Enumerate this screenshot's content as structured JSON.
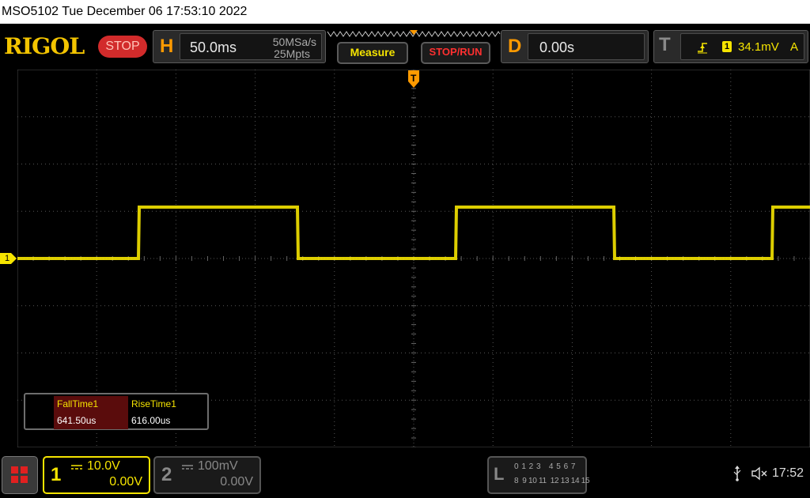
{
  "title_bar": {
    "text": "MSO5102  Tue December 06 17:53:10 2022"
  },
  "brand": {
    "logo_text": "RIGOL",
    "logo_color": "#f3c400"
  },
  "run_state": {
    "label": "STOP",
    "color": "#d22b2b"
  },
  "horizontal": {
    "letter": "H",
    "timebase": "50.0ms",
    "sample_rate": "50MSa/s",
    "memory_depth": "25Mpts"
  },
  "buttons": {
    "measure": "Measure",
    "stop_run": "STOP/RUN"
  },
  "delay": {
    "letter": "D",
    "value": "0.00s"
  },
  "trigger": {
    "letter": "T",
    "source_badge": "1",
    "level": "34.1mV",
    "mode": "A"
  },
  "channel_marker": "1",
  "trigger_marker": "T",
  "measurements": {
    "headers": [
      "FallTime1",
      "RiseTime1"
    ],
    "values": [
      "641.50us",
      "616.00us"
    ]
  },
  "channel1": {
    "number": "1",
    "scale": "10.0V",
    "offset": "0.00V",
    "color": "#f5e400"
  },
  "channel2": {
    "number": "2",
    "scale": "100mV",
    "offset": "0.00V"
  },
  "logic": {
    "letter": "L",
    "row1": "0 1 2 3   4 5 6 7",
    "row2": "8  9 10 11  12 13 14 15"
  },
  "status": {
    "time": "17:52",
    "usb_icon": "usb-icon",
    "speaker_icon": "speaker-muted-icon"
  },
  "colors": {
    "accent": "#ff9a00",
    "trace": "#f5e400",
    "stop": "#d22b2b",
    "grid": "#5a5a5a"
  }
}
